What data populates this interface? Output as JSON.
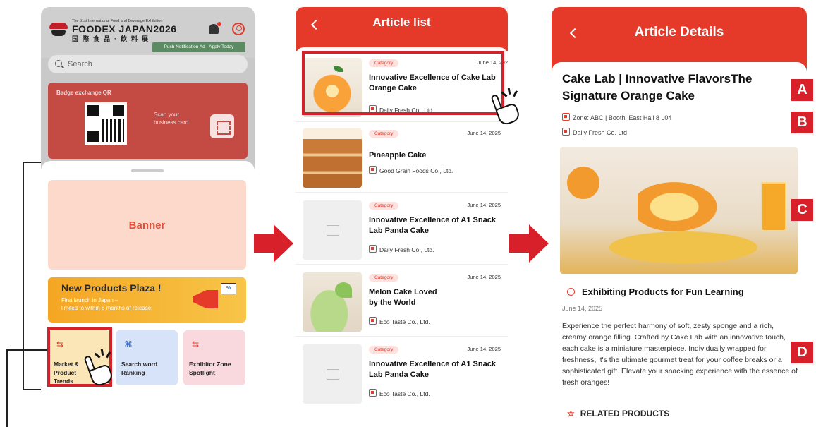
{
  "screen1": {
    "logo": {
      "small_text": "The 51st International Food and Beverage Exhibition",
      "main_text": "FOODEX JAPAN2026",
      "sub_text": "国際食品·飲料展"
    },
    "push_ad": "Push Notification Ad · Apply Today",
    "search_placeholder": "Search",
    "badge": {
      "title": "Badge exchange QR",
      "scan_text": "Scan your business card"
    },
    "banner_label": "Banner",
    "new_products": {
      "title": "New Products Plaza !",
      "subtitle_line1": "First launch in Japan –",
      "subtitle_line2": "limited to within 6 months of release!",
      "tag": "%"
    },
    "tiles": [
      {
        "icon": "⇆",
        "label": "Market & Product Trends"
      },
      {
        "icon": "⌘",
        "label": "Search word Ranking"
      },
      {
        "icon": "⇆",
        "label": "Exhibitor Zone Spotlight"
      }
    ]
  },
  "screen2": {
    "title": "Article list",
    "items": [
      {
        "category": "Category",
        "date": "June 14, 202",
        "title": "Innovative Excellence of Cake Lab Orange Cake",
        "company": "Daily Fresh Co., Ltd."
      },
      {
        "category": "Category",
        "date": "June 14, 2025",
        "title": "Pineapple Cake",
        "company": "Good Grain Foods Co., Ltd."
      },
      {
        "category": "Category",
        "date": "June 14, 2025",
        "title": "Innovative Excellence of A1 Snack Lab Panda Cake",
        "company": "Daily Fresh Co., Ltd."
      },
      {
        "category": "Category",
        "date": "June 14, 2025",
        "title": "Melon Cake Loved by the World",
        "company": "Eco Taste Co., Ltd."
      },
      {
        "category": "Category",
        "date": "June 14, 2025",
        "title": "Innovative Excellence of A1 Snack Lab Panda Cake",
        "company": "Eco Taste Co., Ltd."
      }
    ]
  },
  "screen3": {
    "title": "Article Details",
    "article_title": "Cake Lab | Innovative FlavorsThe Signature Orange Cake",
    "zone_booth": "Zone: ABC  |  Booth: East Hall 8 L04",
    "company": "Daily Fresh  Co. Ltd",
    "section_title": "Exhibiting Products for Fun Learning",
    "date": "June 14, 2025",
    "description": "Experience the perfect harmony of soft, zesty sponge and a rich, creamy orange filling. Crafted by Cake Lab with an innovative touch, each cake is a miniature masterpiece. Individually wrapped for freshness, it's the ultimate gourmet treat for your coffee breaks or a sophisticated gift. Elevate your snacking experience with the essence of fresh oranges!",
    "related": "RELATED PRODUCTS"
  },
  "markers": [
    "A",
    "B",
    "C",
    "D"
  ],
  "colors": {
    "accent": "#e53a2a",
    "highlight": "#d8202a"
  }
}
